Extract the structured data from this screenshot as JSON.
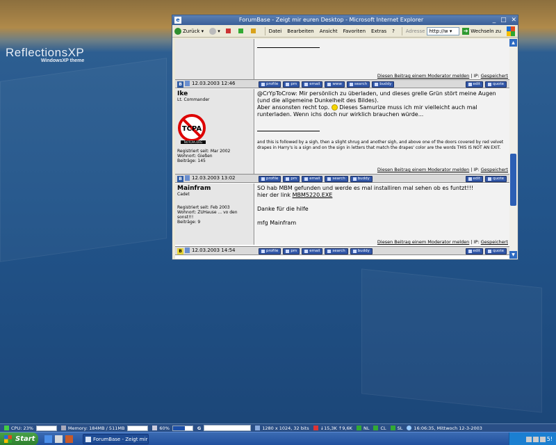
{
  "desktop": {
    "brand_title": "ReflectionsXP",
    "brand_subtitle": "WindowsXP theme"
  },
  "window": {
    "title": "ForumBase - Zeigt mir euren Desktop - Microsoft Internet Explorer",
    "toolbar": {
      "back": "Zurück",
      "menu": [
        "Datei",
        "Bearbeiten",
        "Ansicht",
        "Favoriten",
        "Extras",
        "?"
      ],
      "address_label": "Adresse",
      "address_value": "http://w",
      "go": "Wechseln zu"
    }
  },
  "forum": {
    "report_link": "Diesen Beitrag einem Moderator melden",
    "ip_label": "| IP:",
    "ip_value": "Gespeichert",
    "buttons_left": [
      "profile",
      "pm",
      "email",
      "www",
      "search",
      "buddy"
    ],
    "buttons_right": [
      "edit",
      "quote"
    ],
    "dates": [
      "12.03.2003 12:46",
      "12.03.2003 13:02",
      "12.03.2003 14:54"
    ],
    "posts": [
      {
        "user": "Ike",
        "rank": "Lt. Commander",
        "avatar_text": "TCPA",
        "avatar_sub": "NOTCPA.ORG",
        "registered": "Registriert seit: Mar 2002",
        "location": "Wohnort: Gießen",
        "posts": "Beiträge: 145",
        "line1": "@CrYpToCrow: Mir persönlich zu überladen, und dieses grelle Grün stört meine Augen (und die allgemeine Dunkelheit des Bildes).",
        "line2a": "Aber ansonsten recht top.",
        "line2b": "Dieses Samurize muss ich mir vielleicht auch mal runterladen. Wenn ichs doch nur wirklich brauchen würde...",
        "signature": "and this is followed by a sigh, then a slight shrug and another sigh, and above one of the doors covered by red velvet drapes in Harry's is a sign and on the sign in letters that match the drapes' color are the words THIS IS NOT AN EXIT."
      },
      {
        "user": "Mainfram",
        "rank": "Cadet",
        "registered": "Registriert seit: Feb 2003",
        "location": "Wohnort: ZUHause ... vo den sonst!!!",
        "posts": "Beiträge: 9",
        "line1": "SO hab MBM gefunden und werde es mal installiren mal sehen ob es funtzt!!!",
        "line2": "hier der link",
        "link": "MBM5220.EXE",
        "line3": "Danke für die hilfe",
        "line4": "mfg Mainfram"
      }
    ]
  },
  "statusbar": {
    "cpu": "CPU: 23%",
    "memory": "Memory: 184MB / 511MB",
    "volume": "60%",
    "g": "G",
    "resolution": "1280 x 1024, 32 bits",
    "down": "15,3K",
    "up": "9,6K",
    "nl": "NL",
    "cl": "CL",
    "sl": "SL",
    "clock": "16:06:35, Mittwoch 12-3-2003"
  },
  "taskbar": {
    "start": "Start",
    "task": "ForumBase - Zeigt mir ...",
    "tray_time": "5!"
  }
}
